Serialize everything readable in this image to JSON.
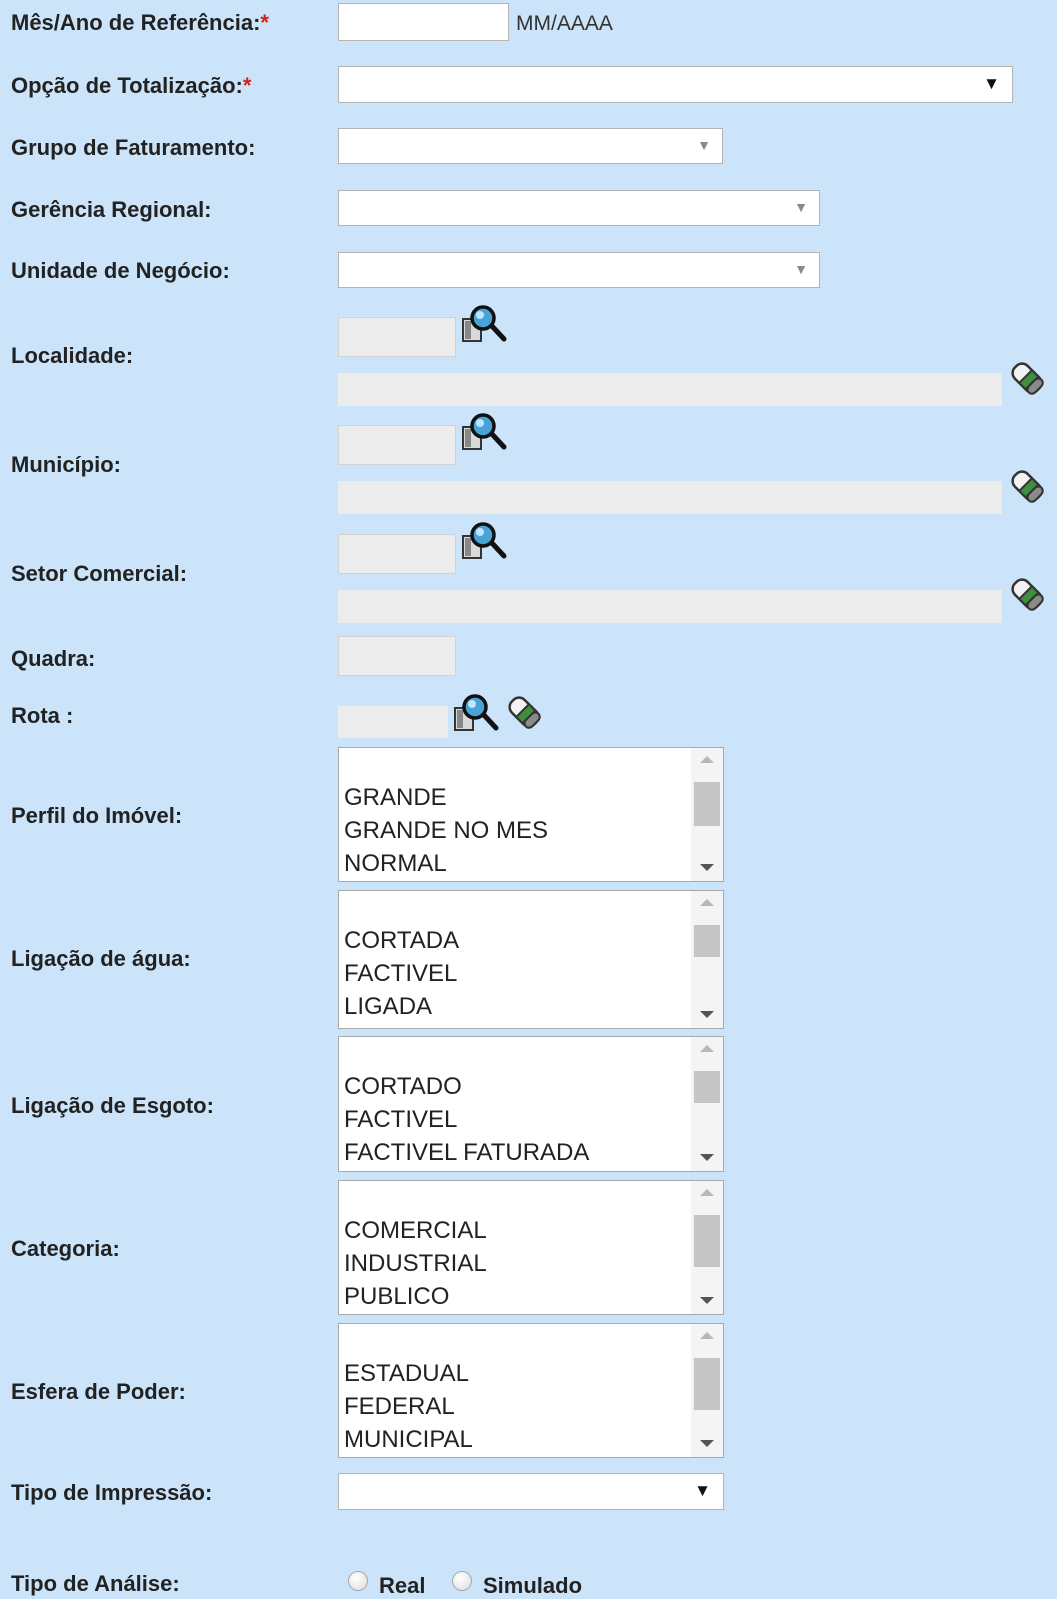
{
  "form": {
    "mes_ano": {
      "label": "Mês/Ano de Referência:",
      "required_mark": "*",
      "value": "",
      "format_hint": "MM/AAAA"
    },
    "opcao_totalizacao": {
      "label": "Opção de Totalização:",
      "required_mark": "*",
      "selected": ""
    },
    "grupo_faturamento": {
      "label": "Grupo de Faturamento:",
      "selected": ""
    },
    "gerencia_regional": {
      "label": "Gerência Regional:",
      "selected": ""
    },
    "unidade_negocio": {
      "label": "Unidade de Negócio:",
      "selected": ""
    },
    "localidade": {
      "label": "Localidade:",
      "code": "",
      "description": ""
    },
    "municipio": {
      "label": "Município:",
      "code": "",
      "description": ""
    },
    "setor_comercial": {
      "label": "Setor Comercial:",
      "code": "",
      "description": ""
    },
    "quadra": {
      "label": "Quadra:",
      "value": ""
    },
    "rota": {
      "label": "Rota :",
      "value": ""
    },
    "perfil_imovel": {
      "label": "Perfil do Imóvel:",
      "options": [
        "GRANDE",
        "GRANDE NO MES",
        "NORMAL"
      ]
    },
    "ligacao_agua": {
      "label": "Ligação de água:",
      "options": [
        "CORTADA",
        "FACTIVEL",
        "LIGADA"
      ]
    },
    "ligacao_esgoto": {
      "label": "Ligação de Esgoto:",
      "options": [
        "CORTADO",
        "FACTIVEL",
        "FACTIVEL FATURADA"
      ]
    },
    "categoria": {
      "label": "Categoria:",
      "options": [
        "COMERCIAL",
        "INDUSTRIAL",
        "PUBLICO"
      ]
    },
    "esfera_poder": {
      "label": "Esfera de Poder:",
      "options": [
        "ESTADUAL",
        "FEDERAL",
        "MUNICIPAL"
      ]
    },
    "tipo_impressao": {
      "label": "Tipo de Impressão:",
      "selected": ""
    },
    "tipo_analise": {
      "label": "Tipo de Análise:",
      "options": [
        "Real",
        "Simulado"
      ]
    }
  },
  "icons": {
    "search": "magnifier-search-icon",
    "clear": "eraser-clear-icon"
  },
  "colors": {
    "background": "#cce4f9",
    "required": "#d21f1f"
  }
}
